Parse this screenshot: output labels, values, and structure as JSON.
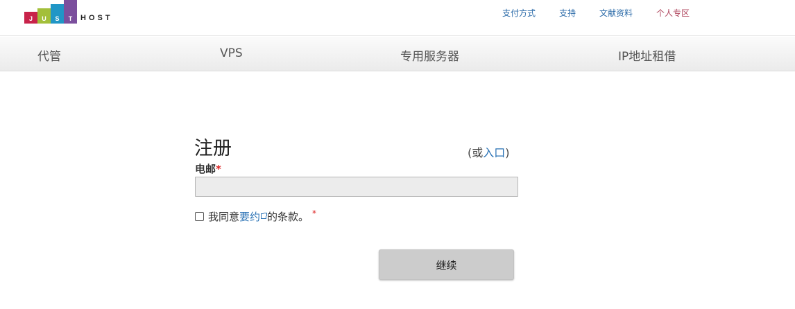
{
  "logo": {
    "letters": [
      "J",
      "U",
      "S",
      "T"
    ],
    "colors": [
      "#c8234a",
      "#a3bf3a",
      "#2096c6",
      "#7b4f9d"
    ],
    "suffix": "HOST"
  },
  "top_links": [
    {
      "label": "支付方式",
      "color": "#2a6aa8"
    },
    {
      "label": "支持",
      "color": "#2a6aa8"
    },
    {
      "label": "文献资料",
      "color": "#2a6aa8"
    },
    {
      "label": "个人专区",
      "color": "#b0475f"
    }
  ],
  "nav": {
    "items": [
      "代管",
      "VPS",
      "专用服务器",
      "IP地址租借"
    ]
  },
  "form": {
    "title": "注册",
    "or_prefix": "(或",
    "login_link": "入口",
    "or_suffix": ")",
    "email_label": "电邮",
    "required_mark": "*",
    "email_value": "",
    "agree_prefix": "我同意",
    "agree_link": "要约",
    "agree_suffix": "的条款。",
    "continue_label": "继续"
  }
}
